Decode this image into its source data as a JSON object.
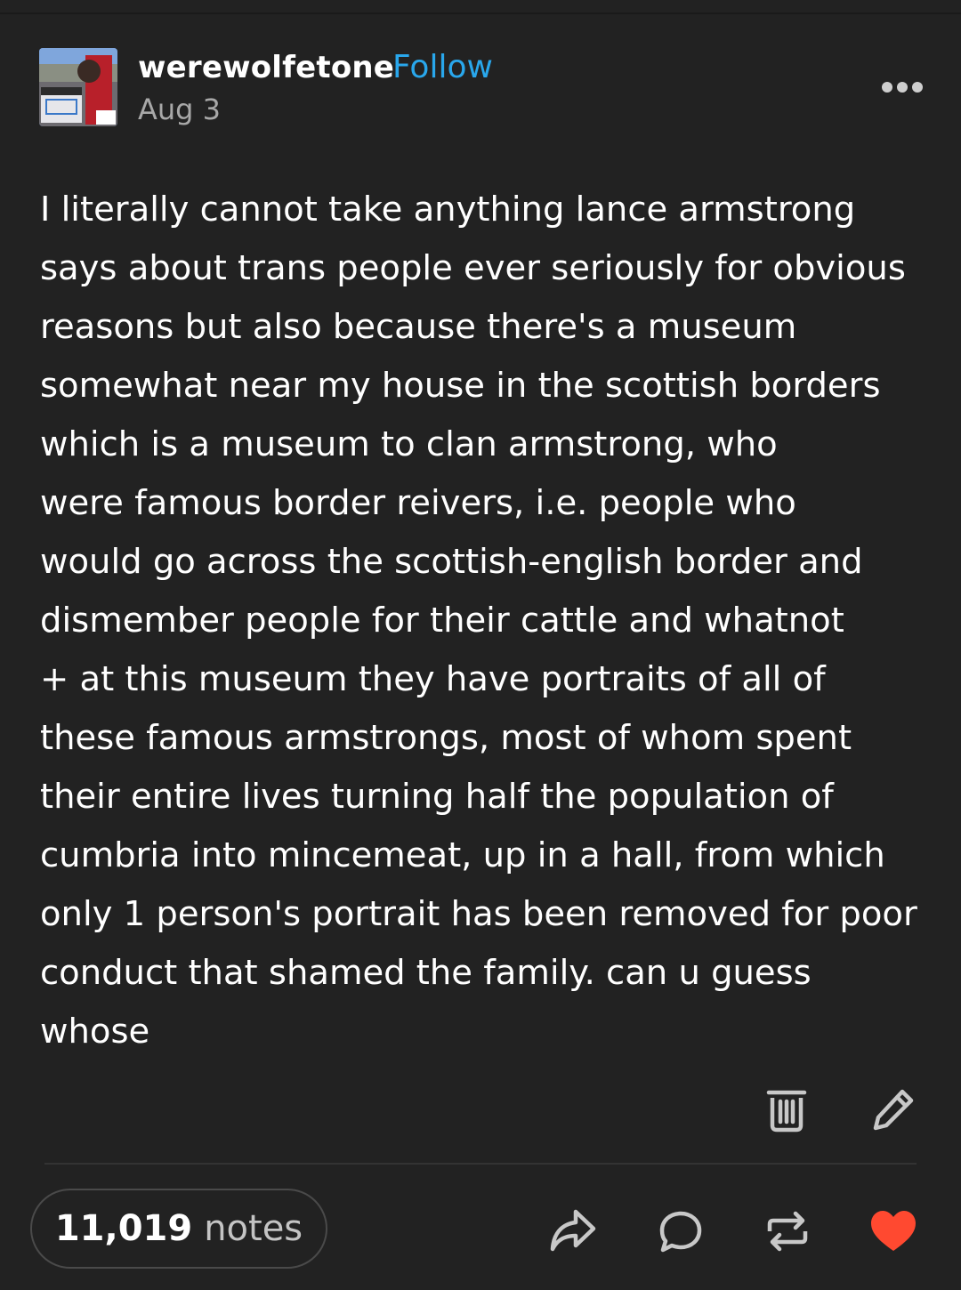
{
  "post": {
    "author": "werewolfetone",
    "follow_label": "Follow",
    "date": "Aug 3",
    "body": "I literally cannot take anything lance armstrong\nsays about trans people ever seriously for obvious\nreasons but also because there's a museum\nsomewhat near my house in the scottish borders\nwhich is a museum to clan armstrong, who\nwere famous border reivers, i.e. people who\nwould go across the scottish-english border and\ndismember people for their cattle and whatnot\n+ at this museum they have portraits of all of\nthese famous armstrongs, most of whom spent\ntheir entire lives turning half the population of\ncumbria into mincemeat, up in a hall, from which\nonly 1 person's portrait has been removed for poor\nconduct that shamed the family. can u guess\nwhose"
  },
  "footer": {
    "notes_count": "11,019",
    "notes_label": "notes"
  },
  "icons": {
    "more": "more-options-icon",
    "delete": "trash-icon",
    "edit": "pencil-icon",
    "share": "share-icon",
    "reply": "reply-icon",
    "reblog": "reblog-icon",
    "like": "heart-icon"
  },
  "colors": {
    "background": "#222222",
    "follow": "#29a7ec",
    "like": "#ff4930",
    "secondary_text": "#a8a8a8"
  }
}
